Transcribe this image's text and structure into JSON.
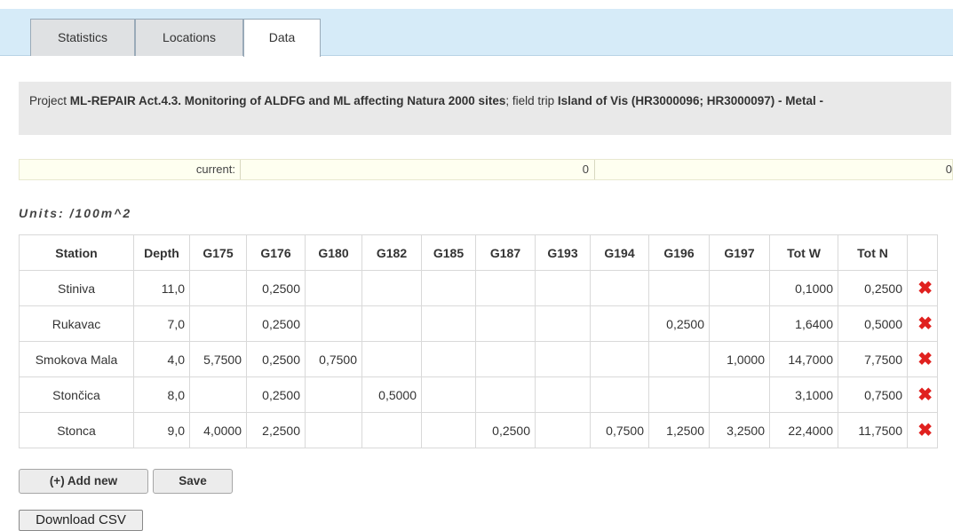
{
  "tabs": [
    {
      "label": "Statistics",
      "active": false
    },
    {
      "label": "Locations",
      "active": false
    },
    {
      "label": "Data",
      "active": true
    }
  ],
  "project": {
    "prefix": "Project ",
    "name": "ML-REPAIR Act.4.3. Monitoring of ALDFG and ML affecting Natura 2000 sites",
    "trip_prefix": "; field trip ",
    "trip": "Island of Vis (HR3000096; HR3000097) - Metal -"
  },
  "current": {
    "label": "current:",
    "value1": "0",
    "value2": "0"
  },
  "units": "Units: /100m^2",
  "table": {
    "headers": [
      "Station",
      "Depth",
      "G175",
      "G176",
      "G180",
      "G182",
      "G185",
      "G187",
      "G193",
      "G194",
      "G196",
      "G197",
      "Tot W",
      "Tot N",
      ""
    ],
    "rows": [
      [
        "Stiniva",
        "11,0",
        "",
        "0,2500",
        "",
        "",
        "",
        "",
        "",
        "",
        "",
        "",
        "0,1000",
        "0,2500"
      ],
      [
        "Rukavac",
        "7,0",
        "",
        "0,2500",
        "",
        "",
        "",
        "",
        "",
        "",
        "0,2500",
        "",
        "1,6400",
        "0,5000"
      ],
      [
        "Smokova Mala",
        "4,0",
        "5,7500",
        "0,2500",
        "0,7500",
        "",
        "",
        "",
        "",
        "",
        "",
        "1,0000",
        "14,7000",
        "7,7500"
      ],
      [
        "Stončica",
        "8,0",
        "",
        "0,2500",
        "",
        "0,5000",
        "",
        "",
        "",
        "",
        "",
        "",
        "3,1000",
        "0,7500"
      ],
      [
        "Stonca",
        "9,0",
        "4,0000",
        "2,2500",
        "",
        "",
        "",
        "0,2500",
        "",
        "0,7500",
        "1,2500",
        "3,2500",
        "22,4000",
        "11,7500"
      ]
    ],
    "delete_glyph": "✖",
    "delete_icon": "delete-x-icon",
    "delete_color": "#e0211f"
  },
  "buttons": {
    "add_new": "(+) Add new",
    "save": "Save",
    "download_csv": "Download CSV"
  },
  "colors": {
    "tab_bar": "#d6ebf8",
    "project_bg": "#e9e9e9",
    "current_bg": "#fefff0"
  }
}
